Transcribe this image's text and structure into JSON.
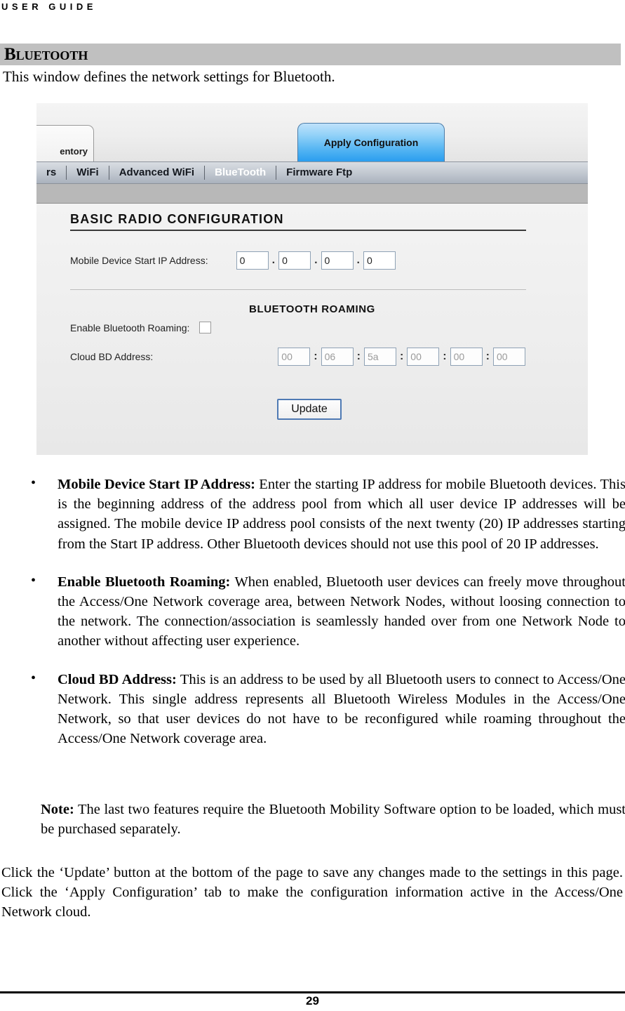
{
  "document": {
    "running_header": "USER GUIDE",
    "section_title": "Bluetooth",
    "intro": "This window defines the network settings for Bluetooth.",
    "page_number": "29"
  },
  "screenshot": {
    "folder_tab": {
      "label": "entory"
    },
    "apply_tab": {
      "label": "Apply Configuration"
    },
    "navbar": {
      "items": [
        {
          "label": "rs",
          "active": false
        },
        {
          "label": "WiFi",
          "active": false
        },
        {
          "label": "Advanced WiFi",
          "active": false
        },
        {
          "label": "BlueTooth",
          "active": true
        },
        {
          "label": "Firmware Ftp",
          "active": false
        }
      ]
    },
    "panel": {
      "heading": "BASIC RADIO CONFIGURATION",
      "ip_field": {
        "label": "Mobile Device Start IP Address:",
        "separator": ".",
        "octets": [
          "0",
          "0",
          "0",
          "0"
        ]
      },
      "roaming": {
        "title": "BLUETOOTH ROAMING",
        "enable_label": "Enable Bluetooth Roaming:",
        "enable_checked": false,
        "bd_label": "Cloud BD Address:",
        "bd_separator": ":",
        "bd_octets": [
          "00",
          "06",
          "5a",
          "00",
          "00",
          "00"
        ]
      },
      "update_button": "Update"
    },
    "colors": {
      "apply_tab_accent": "#4fb2f2",
      "navbar_base": "#aab2bd",
      "section_bar": "#c0c0c0",
      "update_border": "#4f7ab4"
    }
  },
  "body": {
    "bullets": [
      {
        "term": "Mobile Device Start IP Address:",
        "text": " Enter the starting IP address for mobile Bluetooth devices. This is the beginning address of the address pool from which all user device IP addresses will be assigned. The mobile device IP address pool consists of the next twenty (20) IP addresses starting from the Start IP address. Other Bluetooth devices should not use this pool of 20 IP addresses."
      },
      {
        "term": "Enable Bluetooth Roaming:",
        "text": " When enabled, Bluetooth user devices can freely move throughout the Access/One Network coverage area, between Network Nodes, without loosing connection to the network. The connection/association is seamlessly handed over from one Network Node to another without affecting user experience."
      },
      {
        "term": "Cloud BD Address:",
        "text": " This is an address to be used by all Bluetooth users to connect to Access/One Network. This single address represents all Bluetooth Wireless Modules in the Access/One Network, so that user devices do not have to be reconfigured while roaming throughout the Access/One Network coverage area."
      }
    ],
    "note": {
      "term": "Note:",
      "text": " The last two features require the Bluetooth Mobility Software option to be loaded, which must be purchased separately."
    },
    "closing": "Click the ‘Update’ button at the bottom of the page to save any changes made to the settings in this page. Click the ‘Apply Configuration’ tab to make the configuration information active in the Access/One Network cloud."
  }
}
